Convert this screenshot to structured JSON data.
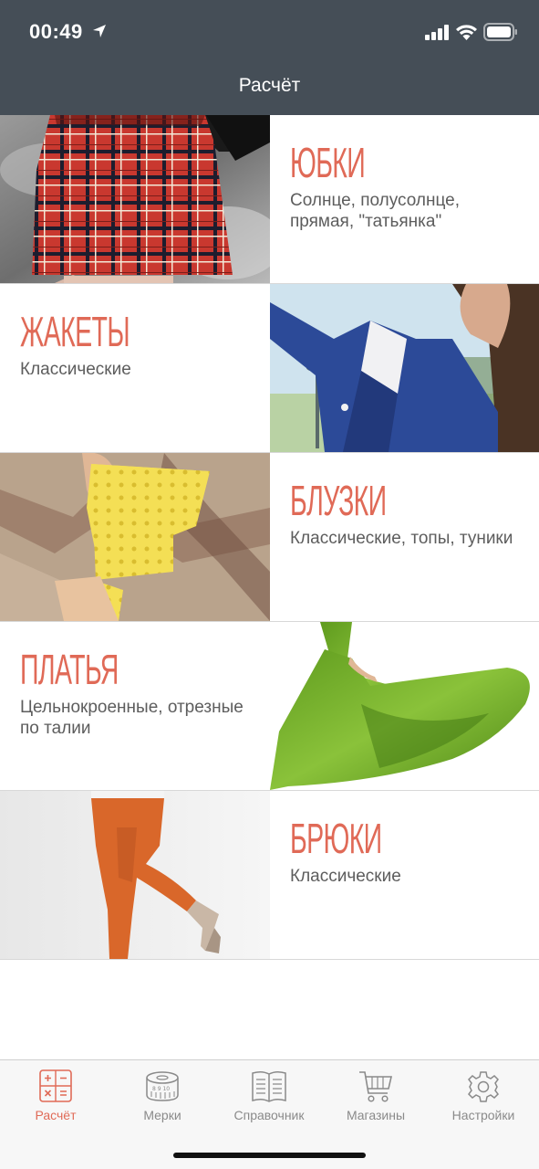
{
  "status_bar": {
    "time": "00:49"
  },
  "nav": {
    "title": "Расчёт"
  },
  "categories": [
    {
      "title": "ЮБКИ",
      "subtitle": "Солнце, полусолнце, прямая, \"татьянка\""
    },
    {
      "title": "ЖАКЕТЫ",
      "subtitle": "Классические"
    },
    {
      "title": "БЛУЗКИ",
      "subtitle": "Классические, топы, туники"
    },
    {
      "title": "ПЛАТЬЯ",
      "subtitle": "Цельнокроенные, отрезные по талии"
    },
    {
      "title": "БРЮКИ",
      "subtitle": "Классические"
    }
  ],
  "tabs": [
    {
      "label": "Расчёт",
      "icon": "calculator-icon",
      "active": true
    },
    {
      "label": "Мерки",
      "icon": "measuring-tape-icon",
      "active": false
    },
    {
      "label": "Справочник",
      "icon": "book-icon",
      "active": false
    },
    {
      "label": "Магазины",
      "icon": "shopping-cart-icon",
      "active": false
    },
    {
      "label": "Настройки",
      "icon": "gear-icon",
      "active": false
    }
  ],
  "colors": {
    "accent": "#e06a57",
    "header_bg": "#454e57",
    "subtitle_text": "#5d5d5d",
    "tab_inactive": "#8a8a8a"
  }
}
